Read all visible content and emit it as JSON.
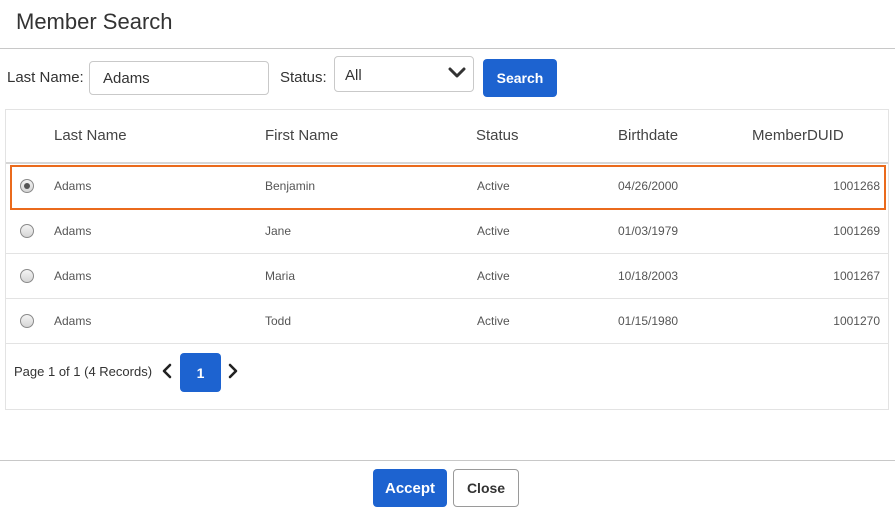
{
  "dialog": {
    "title": "Member Search"
  },
  "filters": {
    "last_name_label": "Last Name:",
    "last_name_value": "Adams",
    "status_label": "Status:",
    "status_value": "All",
    "search_label": "Search"
  },
  "grid": {
    "columns": [
      "Last Name",
      "First Name",
      "Status",
      "Birthdate",
      "MemberDUID"
    ],
    "rows": [
      {
        "last": "Adams",
        "first": "Benjamin",
        "status": "Active",
        "birthdate": "04/26/2000",
        "duid": "1001268",
        "selected": true
      },
      {
        "last": "Adams",
        "first": "Jane",
        "status": "Active",
        "birthdate": "01/03/1979",
        "duid": "1001269",
        "selected": false
      },
      {
        "last": "Adams",
        "first": "Maria",
        "status": "Active",
        "birthdate": "10/18/2003",
        "duid": "1001267",
        "selected": false
      },
      {
        "last": "Adams",
        "first": "Todd",
        "status": "Active",
        "birthdate": "01/15/1980",
        "duid": "1001270",
        "selected": false
      }
    ]
  },
  "pager": {
    "summary": "Page 1 of 1 (4 Records)",
    "current_page": "1"
  },
  "footer": {
    "accept_label": "Accept",
    "close_label": "Close"
  },
  "colors": {
    "primary": "#1d63d0",
    "selection_outline": "#ea6a1c"
  }
}
